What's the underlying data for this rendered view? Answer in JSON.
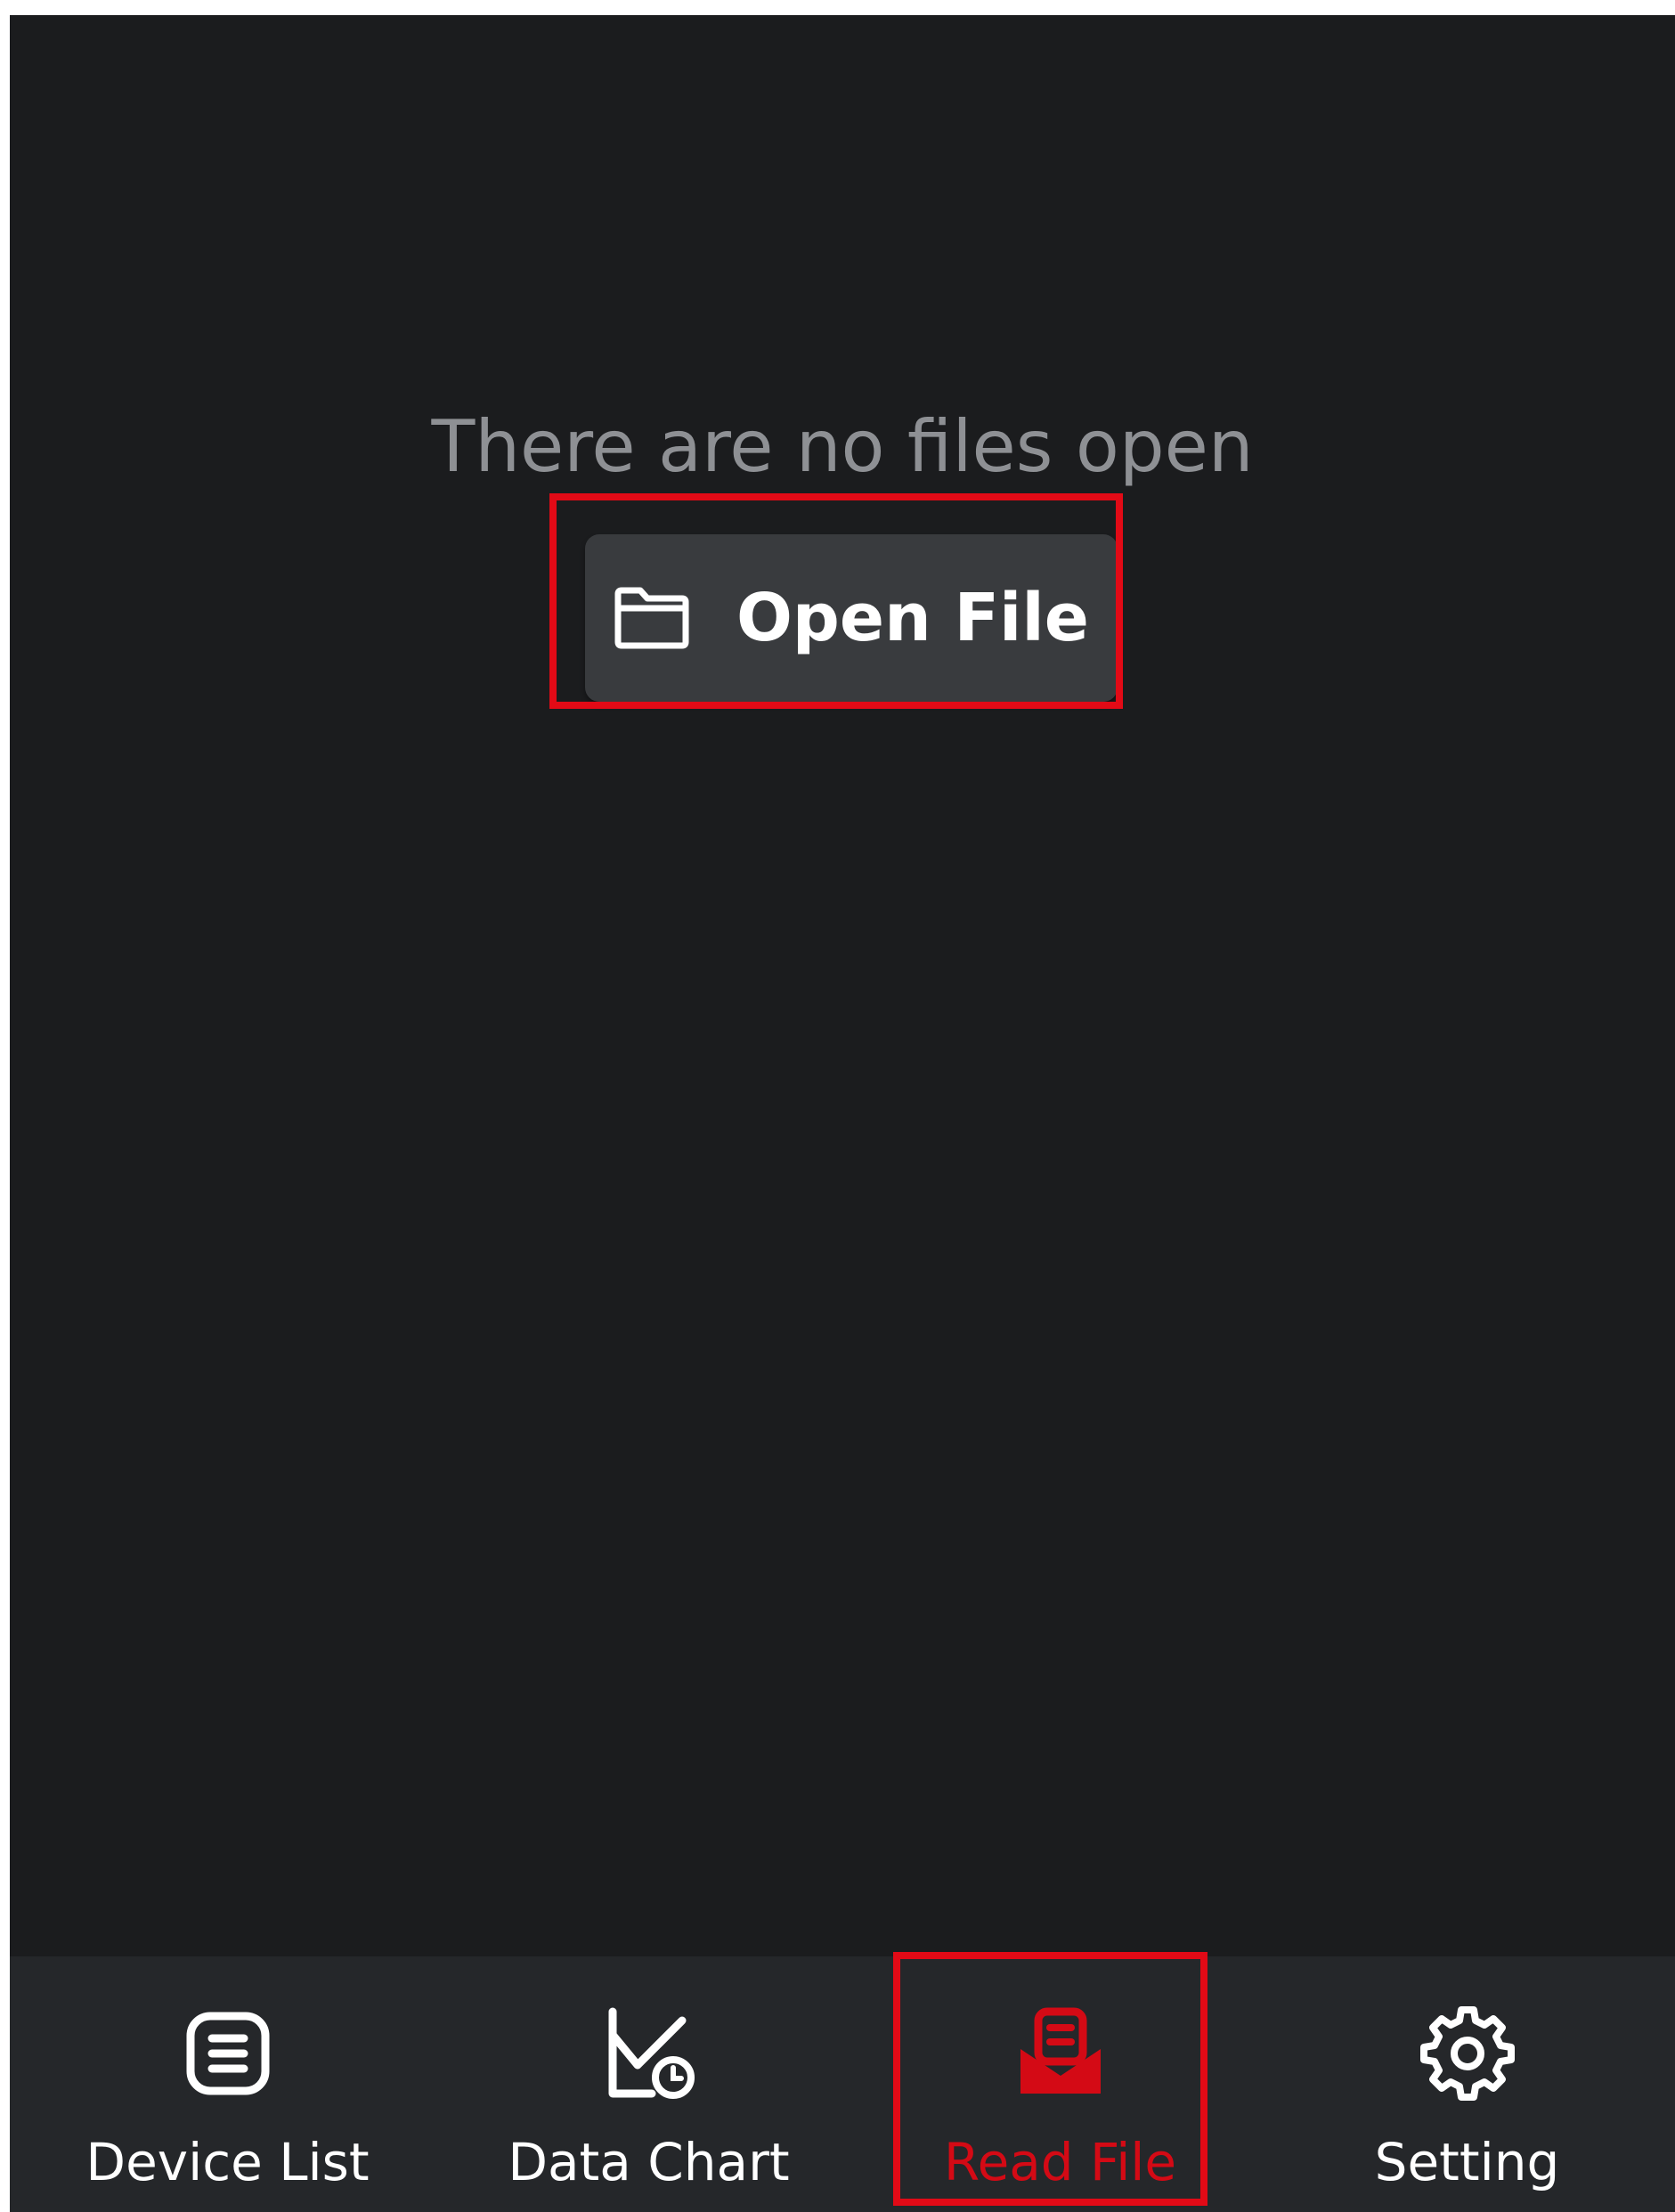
{
  "colors": {
    "background": "#1b1c1e",
    "tabbar_background": "#25272a",
    "button_background": "#393b3e",
    "muted_text": "#8e9094",
    "active_tab": "#d40a15",
    "highlight": "#e20a16"
  },
  "empty_state": {
    "message": "There are no files open",
    "open_button": {
      "label": "Open File",
      "icon": "folder-icon"
    }
  },
  "tabbar": {
    "active_tab": "Read File",
    "tabs": [
      {
        "label": "Device List",
        "icon": "list-icon"
      },
      {
        "label": "Data Chart",
        "icon": "chart-clock-icon"
      },
      {
        "label": "Read File",
        "icon": "mail-open-file-icon"
      },
      {
        "label": "Setting",
        "icon": "gear-icon"
      }
    ]
  }
}
